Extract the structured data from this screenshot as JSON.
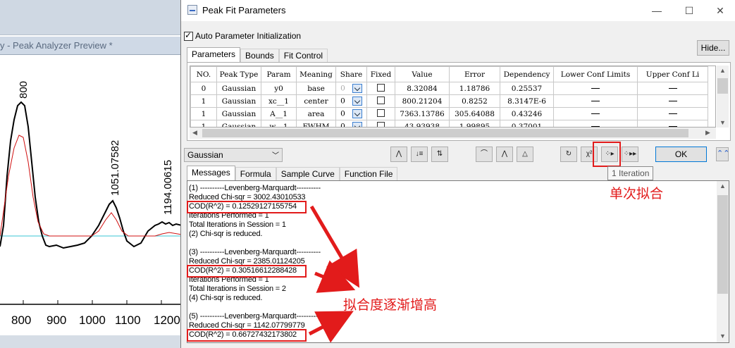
{
  "background_window": {
    "title": "y - Peak Analyzer Preview *",
    "peak_labels": [
      "800",
      "1051.07582",
      "1194.00615"
    ],
    "x_ticks": [
      "800",
      "900",
      "1000",
      "1100",
      "1200"
    ]
  },
  "dialog": {
    "title": "Peak Fit Parameters",
    "auto_param_label": "Auto Parameter Initialization",
    "auto_param_checked": true,
    "hide_label": "Hide...",
    "param_tabs": [
      "Parameters",
      "Bounds",
      "Fit Control"
    ],
    "table": {
      "headers": [
        "NO.",
        "Peak Type",
        "Param",
        "Meaning",
        "Share",
        "Fixed",
        "Value",
        "Error",
        "Dependency",
        "Lower Conf Limits",
        "Upper Conf Li"
      ],
      "rows": [
        {
          "no": "0",
          "type": "Gaussian",
          "param": "y0",
          "meaning": "base",
          "share": "0",
          "value": "8.32084",
          "error": "1.18786",
          "dependency": "0.25537"
        },
        {
          "no": "1",
          "type": "Gaussian",
          "param": "xc__1",
          "meaning": "center",
          "share": "0",
          "value": "800.21204",
          "error": "0.8252",
          "dependency": "8.3147E-6"
        },
        {
          "no": "1",
          "type": "Gaussian",
          "param": "A__1",
          "meaning": "area",
          "share": "0",
          "value": "7363.13786",
          "error": "305.64088",
          "dependency": "0.43246"
        },
        {
          "no": "1",
          "type": "Gaussian",
          "param": "w__1",
          "meaning": "FWHM",
          "share": "0",
          "value": "43.93938",
          "error": "1.99895",
          "dependency": "0.37001"
        }
      ]
    },
    "peak_type_select": "Gaussian",
    "ok_label": "OK",
    "chi_label": "χ²",
    "tooltip": "1 Iteration",
    "msg_tabs": [
      "Messages",
      "Formula",
      "Sample Curve",
      "Function File"
    ],
    "messages": [
      "(1) ----------Levenberg-Marquardt----------",
      "Reduced Chi-sqr = 3002.43010533",
      "COD(R^2) = 0.12529127155754",
      "Iterations Performed = 1",
      "Total Iterations in Session = 1",
      "(2) Chi-sqr is reduced.",
      "",
      "(3) ----------Levenberg-Marquardt----------",
      "Reduced Chi-sqr = 2385.01124205",
      "COD(R^2) = 0.30516612288428",
      "Iterations Performed = 1",
      "Total Iterations in Session = 2",
      "(4) Chi-sqr is reduced.",
      "",
      "(5) ----------Levenberg-Marquardt----------",
      "Reduced Chi-sqr = 1142.07799779",
      "COD(R^2) = 0.66727432173802"
    ]
  },
  "annotations": {
    "single_fit": "单次拟合",
    "fit_increasing": "拟合度逐渐增高",
    "color": "#e21b1b"
  }
}
